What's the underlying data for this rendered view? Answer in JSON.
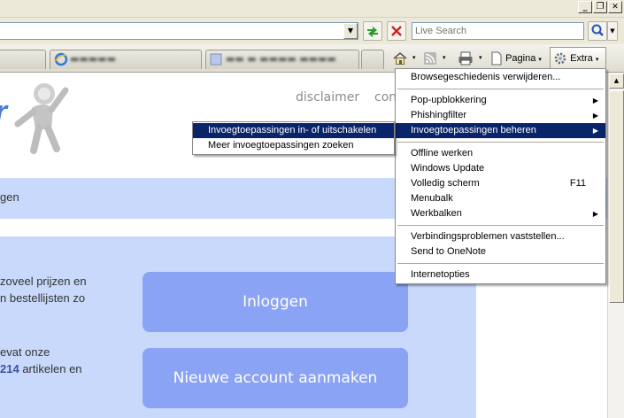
{
  "window": {
    "minimize": "_",
    "restore": "❐",
    "close": "✕"
  },
  "toolbar": {
    "address_dropdown": "▼",
    "search_placeholder": "Live Search",
    "tab_arrow": "▾",
    "page_label": "Pagina",
    "tools_label": "Extra"
  },
  "page": {
    "nav_links": [
      "disclaimer",
      "con"
    ],
    "band_text": "gen",
    "intro_lines": [
      "zoveel prijzen en",
      "n bestellijsten zo"
    ],
    "stats_line1": "evat onze",
    "stats_count": "214",
    "stats_line2_rest": " artikelen en",
    "login_button": "Inloggen",
    "new_account_button": "Nieuwe account aanmaken"
  },
  "tools_menu": {
    "items": [
      {
        "label": "Browsegeschiedenis verwijderen..."
      },
      {
        "label": "Pop-upblokkering",
        "submenu": true
      },
      {
        "label": "Phishingfilter",
        "submenu": true
      },
      {
        "label": "Invoegtoepassingen beheren",
        "submenu": true,
        "highlighted": true
      },
      {
        "label": "Offline werken"
      },
      {
        "label": "Windows Update"
      },
      {
        "label": "Volledig scherm",
        "shortcut": "F11"
      },
      {
        "label": "Menubalk"
      },
      {
        "label": "Werkbalken",
        "submenu": true
      },
      {
        "label": "Verbindingsproblemen vaststellen..."
      },
      {
        "label": "Send to OneNote"
      },
      {
        "label": "Internetopties"
      }
    ],
    "submenu_arrow": "▶"
  },
  "addons_submenu": {
    "items": [
      {
        "label": "Invoegtoepassingen in- of uitschakelen",
        "highlighted": true
      },
      {
        "label": "Meer invoegtoepassingen zoeken"
      }
    ]
  },
  "scrollbar": {
    "up_arrow": "▲"
  },
  "colors": {
    "menu_highlight": "#0a246a",
    "button_blue": "#8ba3f4",
    "band_blue": "#c9d9fb"
  }
}
